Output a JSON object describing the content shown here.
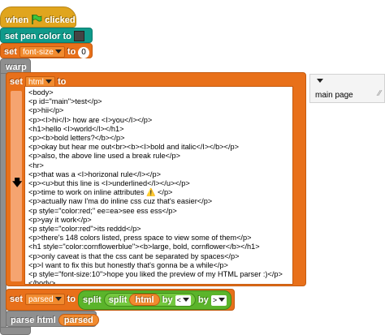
{
  "hat": {
    "when": "when",
    "clicked": "clicked"
  },
  "pen_color": {
    "label": "set pen color to",
    "color": "#444444"
  },
  "set_font": {
    "set": "set",
    "var": "font-size",
    "to": "to",
    "value": "0"
  },
  "warp": {
    "label": "warp"
  },
  "set_html": {
    "set": "set",
    "var": "html",
    "to": "to"
  },
  "code_lines": [
    "<body>",
    "<p id=\"main\">test</p>",
    "<p>hii</p>",
    "<p><I>hi</I> how are <I>you</I></p>",
    "<h1>hello <I>world</I></h1>",
    "<p><b>bold letters?</b></p>",
    "<p>okay but hear me out<br><b><I>bold and italic</I></b></p>",
    "<p>also, the above line used a break rule</p>",
    "<hr>",
    "<p>that was a <I>horizonal rule</I></p>",
    "<p><u>but this line is <I>underlined</I></u></p>",
    "<p>time to work on inline attributes ⚠️ </p>",
    "<p>actually naw I'ma do inline css cuz that's easier</p>",
    "<p style=\"color:red;\" ee=ea>see ess ess</p>",
    "<p>yay it work</p>",
    "<p style=\"color:red\">its reddd</p>",
    "<p>there's 148 colors listed, press space to view some of them</p>",
    "<h1 style=\"color:cornflowerblue\"><b>large, bold, cornflower</b></h1>",
    "<p>only caveat is that the css cant be separated by spaces</p>",
    "<p>I want to fix this but honestly that's gonna be a while</p>",
    "<p style=\"font-size:10\">hope you liked the preview of my HTML parser :)</p>",
    "</body>"
  ],
  "set_parsed": {
    "set": "set",
    "var": "parsed",
    "to": "to",
    "split_outer": "split",
    "split_inner": "split",
    "html": "html",
    "by": "by",
    "by_outer": "by",
    "opt1": "<",
    "opt2": ">"
  },
  "parse_html": {
    "label": "parse html",
    "var": "parsed"
  },
  "side_dropdown": {
    "value": "main page"
  },
  "colors": {
    "control": "#e0a51e",
    "pen": "#0f9a8a",
    "variables": "#e8701a",
    "other": "#8f8f8f",
    "operators": "#5bb42b"
  }
}
